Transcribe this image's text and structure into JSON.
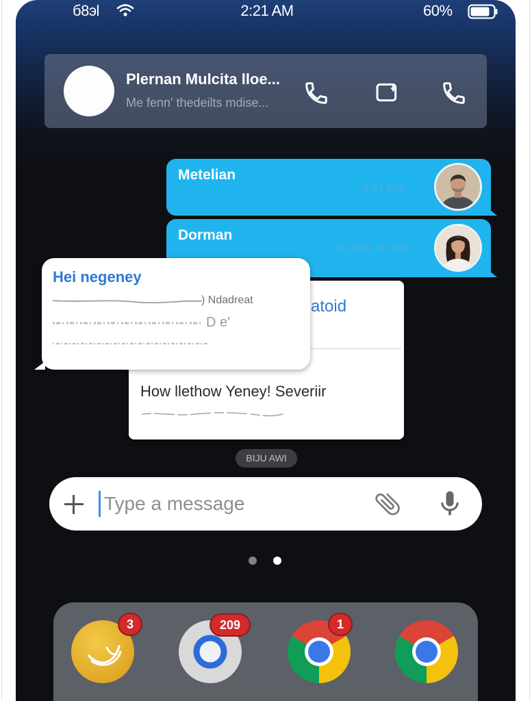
{
  "status_bar": {
    "carrier": "б8эl",
    "time": "2:21 AM",
    "battery": "60%",
    "icons": [
      "wifi-icon",
      "battery-icon"
    ]
  },
  "header": {
    "title": "Plernan Mulcita lloe...",
    "subtitle": "Me fenn' thedeilts mdise...",
    "actions": [
      "phone-icon",
      "video-icon",
      "phone-icon"
    ]
  },
  "messages": [
    {
      "sender": "Metelian",
      "time": "8 01 PM"
    },
    {
      "sender": "Dorman",
      "time": "11.0NG 3F P04"
    }
  ],
  "cards": {
    "front": {
      "title": "Hei negeney",
      "line1": ") Ndadreat",
      "line2": "D e'"
    },
    "back": {
      "title": "atoid",
      "body": "How llethow Yeney! Severiir"
    }
  },
  "time_pill": "BIJU AWI",
  "composer": {
    "placeholder": "Type a message",
    "icons": [
      "plus-icon",
      "paperclip-icon",
      "microphone-icon"
    ]
  },
  "pager": {
    "dots": 2,
    "active_index": 1
  },
  "dock": {
    "apps": [
      {
        "icon": "yellow-swoosh-app-icon",
        "badge": "3"
      },
      {
        "icon": "blue-ring-app-icon",
        "badge": "209"
      },
      {
        "icon": "chrome-icon",
        "badge": "1"
      },
      {
        "icon": "chrome-icon",
        "badge": ""
      }
    ]
  },
  "colors": {
    "bubble": "#1fb4ee",
    "accent": "#2f7ad4",
    "badge": "#d32a2a",
    "screen": "#0e0f13"
  }
}
